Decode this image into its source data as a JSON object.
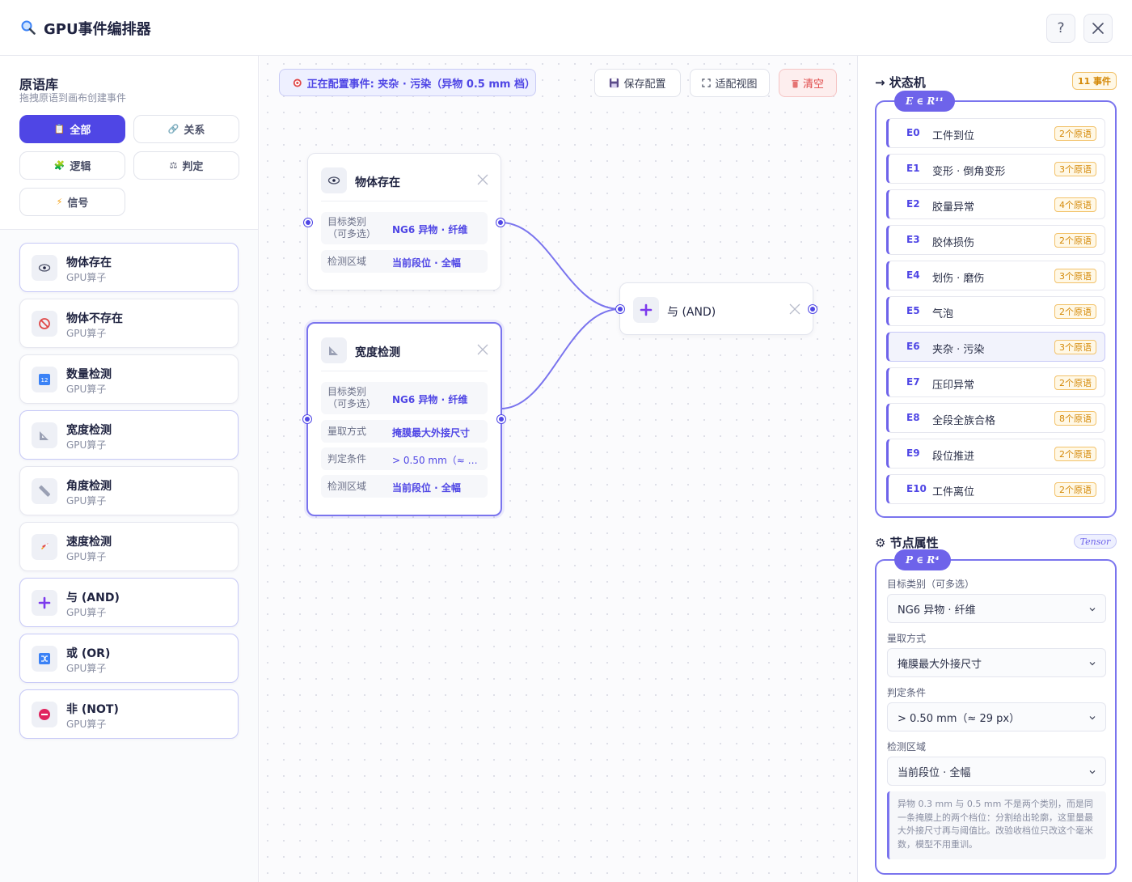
{
  "app": {
    "title": "GPU事件编排器",
    "help_label": "?"
  },
  "library": {
    "title": "原语库",
    "subtitle": "拖拽原语到画布创建事件",
    "filters": [
      {
        "icon": "📋",
        "label": "全部"
      },
      {
        "icon": "🔗",
        "label": "关系"
      },
      {
        "icon": "🧩",
        "label": "逻辑"
      },
      {
        "icon": "⚖",
        "label": "判定"
      },
      {
        "icon": "⚡",
        "label": "信号"
      }
    ],
    "primitives": [
      {
        "name": "物体存在",
        "sub": "GPU算子",
        "icon": "eye-icon"
      },
      {
        "name": "物体不存在",
        "sub": "GPU算子",
        "icon": "prohibited-icon"
      },
      {
        "name": "数量检测",
        "sub": "GPU算子",
        "icon": "numbers-icon"
      },
      {
        "name": "宽度检测",
        "sub": "GPU算子",
        "icon": "ruler-triangle-icon"
      },
      {
        "name": "角度检测",
        "sub": "GPU算子",
        "icon": "ruler-icon"
      },
      {
        "name": "速度检测",
        "sub": "GPU算子",
        "icon": "rocket-icon"
      },
      {
        "name": "与 (AND)",
        "sub": "GPU算子",
        "icon": "plus-icon"
      },
      {
        "name": "或 (OR)",
        "sub": "GPU算子",
        "icon": "shuffle-icon"
      },
      {
        "name": "非 (NOT)",
        "sub": "GPU算子",
        "icon": "minus-circle-icon"
      }
    ]
  },
  "canvas": {
    "config_label": "正在配置事件: 夹杂 · 污染（异物 0.5 mm 档）",
    "save_label": "保存配置",
    "fit_label": "适配视图",
    "clear_label": "清空",
    "nodes": {
      "exist": {
        "title": "物体存在",
        "rows": [
          {
            "label": "目标类别\n（可多选）",
            "value": "NG6 异物 · 纤维"
          },
          {
            "label": "检测区域",
            "value": "当前段位 · 全幅"
          }
        ]
      },
      "width": {
        "title": "宽度检测",
        "rows": [
          {
            "label": "目标类别\n（可多选）",
            "value": "NG6 异物 · 纤维"
          },
          {
            "label": "量取方式",
            "value": "掩膜最大外接尺寸"
          },
          {
            "label": "判定条件",
            "value": "> 0.50 mm（≈ 29 px）"
          },
          {
            "label": "检测区域",
            "value": "当前段位 · 全幅"
          }
        ]
      },
      "and": {
        "title": "与 (AND)"
      }
    }
  },
  "state_machine": {
    "title": "→ 状态机",
    "badge": "11 事件",
    "math": "E ∈ R¹¹",
    "selected": "E6",
    "events": [
      {
        "id": "E0",
        "name": "工件到位",
        "count": "2个原语"
      },
      {
        "id": "E1",
        "name": "变形 · 倒角变形",
        "count": "3个原语"
      },
      {
        "id": "E2",
        "name": "胶量异常",
        "count": "4个原语"
      },
      {
        "id": "E3",
        "name": "胶体损伤",
        "count": "2个原语"
      },
      {
        "id": "E4",
        "name": "划伤 · 磨伤",
        "count": "3个原语"
      },
      {
        "id": "E5",
        "name": "气泡",
        "count": "2个原语"
      },
      {
        "id": "E6",
        "name": "夹杂 · 污染",
        "count": "3个原语"
      },
      {
        "id": "E7",
        "name": "压印异常",
        "count": "2个原语"
      },
      {
        "id": "E8",
        "name": "全段全族合格",
        "count": "8个原语"
      },
      {
        "id": "E9",
        "name": "段位推进",
        "count": "2个原语"
      },
      {
        "id": "E10",
        "name": "工件离位",
        "count": "2个原语"
      }
    ]
  },
  "properties": {
    "title": "⚙ 节点属性",
    "badge": "Tensor",
    "math": "P ∈ R⁴",
    "fields": [
      {
        "label": "目标类别（可多选）",
        "value": "NG6 异物 · 纤维"
      },
      {
        "label": "量取方式",
        "value": "掩膜最大外接尺寸"
      },
      {
        "label": "判定条件",
        "value": "> 0.50 mm（≈ 29 px）"
      },
      {
        "label": "检测区域",
        "value": "当前段位 · 全幅"
      }
    ],
    "note": "异物 0.3 mm 与 0.5 mm 不是两个类别，而是同一条掩膜上的两个档位：分割给出轮廓，这里量最大外接尺寸再与阈值比。改验收档位只改这个毫米数，模型不用重训。"
  },
  "colors": {
    "accent": "#4f46e5",
    "warning": "#d48806",
    "danger": "#e04848"
  }
}
